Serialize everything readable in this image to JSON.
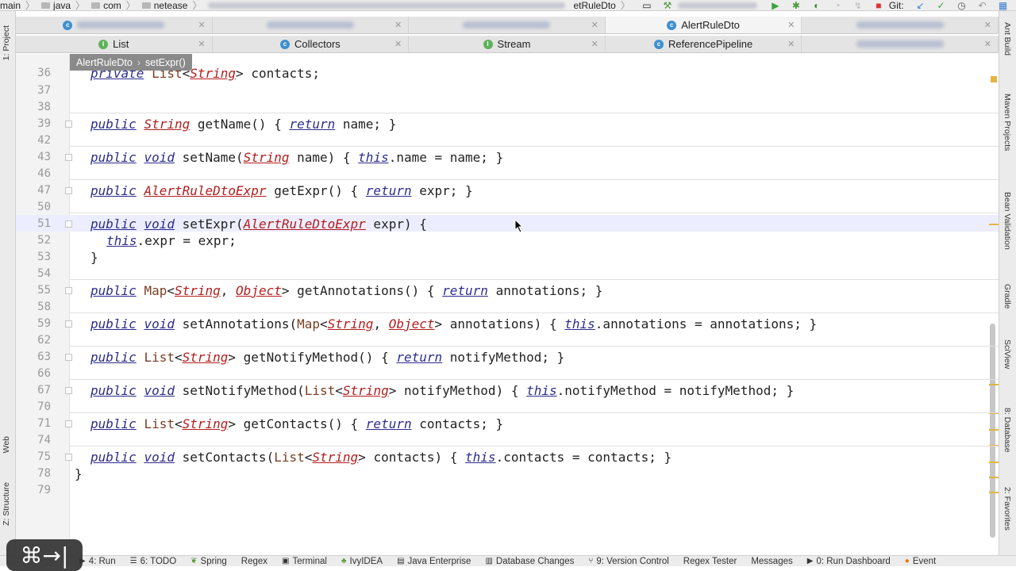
{
  "navbar": {
    "crumbs": [
      "main",
      "java",
      "com",
      "netease",
      "etRuleDto"
    ],
    "git_label": "Git:"
  },
  "left_tools": {
    "project": "1: Project",
    "web": "Web",
    "structure": "Z: Structure"
  },
  "right_tools": [
    "Ant Build",
    "Maven Projects",
    "Bean Validation",
    "Gradle",
    "SciView",
    "8: Database",
    "2: Favorites"
  ],
  "tabs_row1": [
    {
      "label": "",
      "blurred": true
    },
    {
      "label": "",
      "blurred": true
    },
    {
      "label": "",
      "blurred": true
    },
    {
      "label": "AlertRuleDto",
      "icon": "C",
      "active": true
    },
    {
      "label": "",
      "blurred": true
    }
  ],
  "tabs_row2": [
    {
      "label": "List",
      "icon": "I"
    },
    {
      "label": "Collectors",
      "icon": "C"
    },
    {
      "label": "Stream",
      "icon": "I"
    },
    {
      "label": "ReferencePipeline",
      "icon": "C"
    },
    {
      "label": "",
      "blurred": true
    }
  ],
  "breadcrumb": {
    "class": "AlertRuleDto",
    "method": "setExpr()"
  },
  "code_lines": [
    {
      "num": "36",
      "text": "private List<String> contacts;"
    },
    {
      "num": "37",
      "text": ""
    },
    {
      "num": "38",
      "text": ""
    },
    {
      "num": "39",
      "text": "public String getName() { return name; }"
    },
    {
      "num": "42",
      "text": ""
    },
    {
      "num": "43",
      "text": "public void setName(String name) { this.name = name; }"
    },
    {
      "num": "46",
      "text": ""
    },
    {
      "num": "47",
      "text": "public AlertRuleDtoExpr getExpr() { return expr; }"
    },
    {
      "num": "50",
      "text": ""
    },
    {
      "num": "51",
      "text": "public void setExpr(AlertRuleDtoExpr expr) {"
    },
    {
      "num": "52",
      "text": "this.expr = expr;"
    },
    {
      "num": "53",
      "text": "}"
    },
    {
      "num": "54",
      "text": ""
    },
    {
      "num": "55",
      "text": "public Map<String, Object> getAnnotations() { return annotations; }"
    },
    {
      "num": "58",
      "text": ""
    },
    {
      "num": "59",
      "text": "public void setAnnotations(Map<String, Object> annotations) { this.annotations = annotations; }"
    },
    {
      "num": "62",
      "text": ""
    },
    {
      "num": "63",
      "text": "public List<String> getNotifyMethod() { return notifyMethod; }"
    },
    {
      "num": "66",
      "text": ""
    },
    {
      "num": "67",
      "text": "public void setNotifyMethod(List<String> notifyMethod) { this.notifyMethod = notifyMethod; }"
    },
    {
      "num": "70",
      "text": ""
    },
    {
      "num": "71",
      "text": "public List<String> getContacts() { return contacts; }"
    },
    {
      "num": "74",
      "text": ""
    },
    {
      "num": "75",
      "text": "public void setContacts(List<String> contacts) { this.contacts = contacts; }"
    },
    {
      "num": "78",
      "text": "}"
    },
    {
      "num": "79",
      "text": ""
    }
  ],
  "bottom_tools": [
    "4: Run",
    "6: TODO",
    "Spring",
    "Regex",
    "Terminal",
    "IvyIDEA",
    "Java Enterprise",
    "Database Changes",
    "9: Version Control",
    "Regex Tester",
    "Messages",
    "0: Run Dashboard",
    "Event"
  ],
  "keyboard_badge": "⌘→|",
  "colors": {
    "keyword": "#2c2c8d",
    "type": "#b31d1d",
    "highlight": "#b3d7f5",
    "current_line": "#eceeff"
  }
}
